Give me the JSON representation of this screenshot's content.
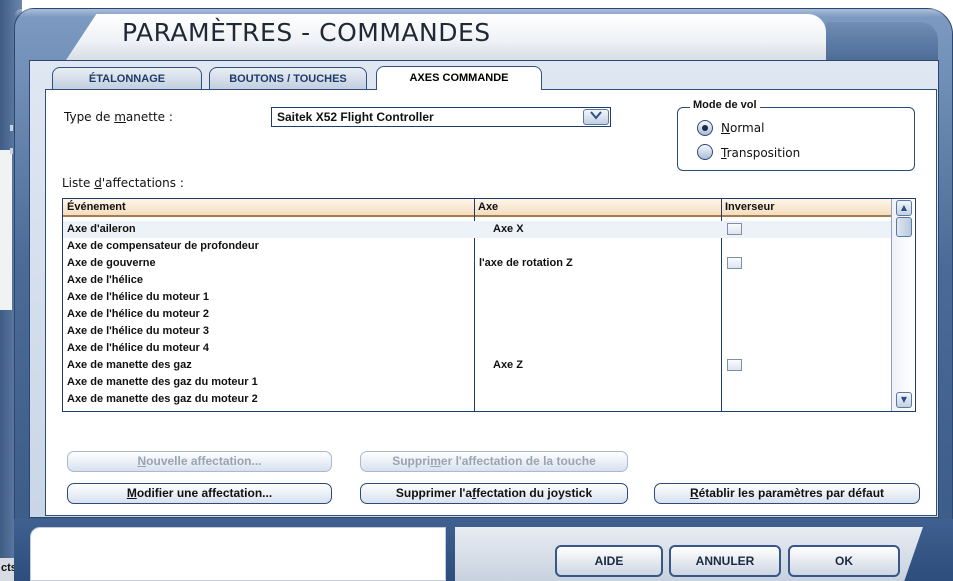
{
  "background": {
    "left_fragment_text": "cts"
  },
  "dialog": {
    "title": "PARAMÈTRES - COMMANDES",
    "tabs": [
      {
        "label": "ÉTALONNAGE",
        "active": false
      },
      {
        "label": "BOUTONS / TOUCHES",
        "active": false
      },
      {
        "label": "AXES COMMANDE",
        "active": true
      }
    ]
  },
  "controller": {
    "label_pre": "Type de ",
    "label_u": "m",
    "label_post": "anette :",
    "selected": "Saitek X52 Flight Controller"
  },
  "flight_mode": {
    "legend": "Mode de vol",
    "options": [
      {
        "u": "N",
        "rest": "ormal",
        "checked": true
      },
      {
        "u": "T",
        "rest": "ransposition",
        "checked": false
      }
    ]
  },
  "assignments": {
    "label_pre": "Liste ",
    "label_u": "d",
    "label_post": "'affectations :",
    "columns": [
      "Événement",
      "Axe",
      "Inverseur"
    ],
    "rows": [
      {
        "event": "Axe d'aileron",
        "axis": "Axe X",
        "inverter": true
      },
      {
        "event": "Axe de compensateur de profondeur",
        "axis": "",
        "inverter": false
      },
      {
        "event": "Axe de gouverne",
        "axis": "l'axe de rotation Z",
        "inverter": true
      },
      {
        "event": "Axe de l'hélice",
        "axis": "",
        "inverter": false
      },
      {
        "event": "Axe de l'hélice du moteur 1",
        "axis": "",
        "inverter": false
      },
      {
        "event": "Axe de l'hélice du moteur 2",
        "axis": "",
        "inverter": false
      },
      {
        "event": "Axe de l'hélice du moteur 3",
        "axis": "",
        "inverter": false
      },
      {
        "event": "Axe de l'hélice du moteur 4",
        "axis": "",
        "inverter": false
      },
      {
        "event": "Axe de manette des gaz",
        "axis": "Axe Z",
        "inverter": true
      },
      {
        "event": "Axe de manette des gaz du moteur 1",
        "axis": "",
        "inverter": false
      },
      {
        "event": "Axe de manette des gaz du moteur 2",
        "axis": "",
        "inverter": false
      }
    ]
  },
  "actions": {
    "new_assignment": {
      "u": "N",
      "rest": "ouvelle affectation..."
    },
    "delete_key": {
      "pre": "Suppri",
      "u": "m",
      "post": "er l'affectation de la touche"
    },
    "modify_assignment": {
      "u": "M",
      "rest": "odifier une affectation..."
    },
    "delete_joystick": {
      "pre": "Supprimer l'a",
      "u": "f",
      "post": "fectation du joystick"
    },
    "restore_defaults": {
      "u": "R",
      "rest": "établir les paramètres par défaut"
    }
  },
  "footer": {
    "help": "AIDE",
    "cancel": "ANNULER",
    "ok": "OK"
  }
}
